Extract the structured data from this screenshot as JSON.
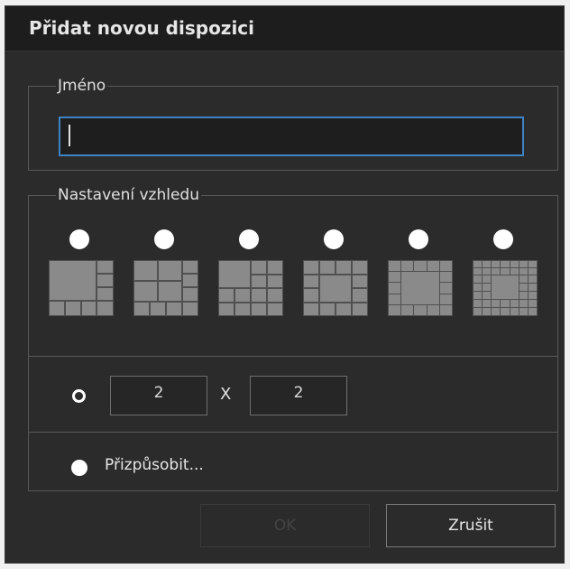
{
  "dialog": {
    "title": "Přidat novou dispozici"
  },
  "name_group": {
    "legend": "Jméno",
    "value": ""
  },
  "layout_group": {
    "legend": "Nastavení vzhledu",
    "presets": [
      {
        "name": "layout-1-plus-7-icon"
      },
      {
        "name": "layout-2x2-plus-8-icon"
      },
      {
        "name": "layout-1-plus-12-icon"
      },
      {
        "name": "layout-1-plus-16-icon"
      },
      {
        "name": "layout-1-plus-20-icon"
      },
      {
        "name": "layout-1-plus-32-icon"
      }
    ],
    "custom_grid": {
      "cols": "2",
      "separator": "X",
      "rows": "2"
    },
    "customize_label": "Přizpůsobit..."
  },
  "buttons": {
    "ok": "OK",
    "cancel": "Zrušit"
  },
  "colors": {
    "background": "#2b2b2b",
    "titlebar": "#1d1d1d",
    "accent_focus": "#3f84c6",
    "tile": "#8a8a8a"
  }
}
